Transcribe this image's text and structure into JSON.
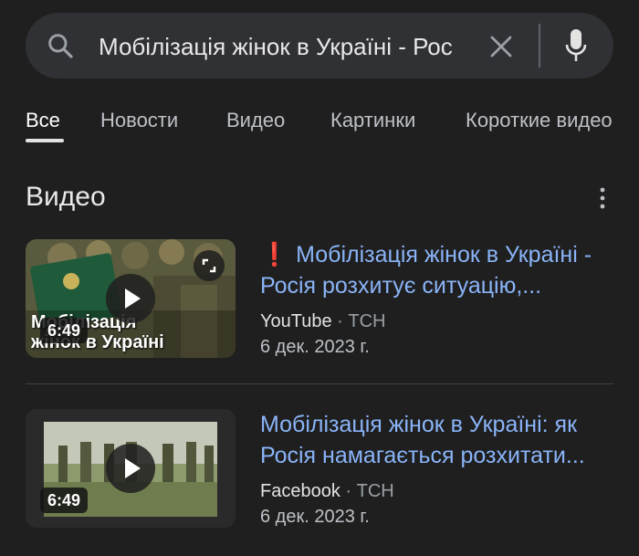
{
  "search": {
    "query": "Мобілізація жінок в Україні - Рос"
  },
  "tabs": [
    {
      "label": "Все",
      "active": true
    },
    {
      "label": "Новости",
      "active": false
    },
    {
      "label": "Видео",
      "active": false
    },
    {
      "label": "Картинки",
      "active": false
    },
    {
      "label": "Короткие видео",
      "active": false
    }
  ],
  "section": {
    "title": "Видео"
  },
  "videos": [
    {
      "title": "Мобілізація жінок в Україні - Росія розхитує ситуацію,...",
      "platform": "YouTube",
      "separator": " · ",
      "channel": "ТСН",
      "date": "6 дек. 2023 г.",
      "duration": "6:49",
      "thumb_caption_line1": "Мобілізація",
      "thumb_caption_line2": "жінок в Україні",
      "has_alert_icon": true
    },
    {
      "title": "Мобілізація жінок в Україні: як Росія намагається розхитати...",
      "platform": "Facebook",
      "separator": " · ",
      "channel": "ТСН",
      "date": "6 дек. 2023 г.",
      "duration": "6:49",
      "has_alert_icon": false
    }
  ],
  "icons": {
    "search": "search-icon",
    "clear": "close-icon",
    "mic": "mic-icon",
    "more": "more-vert-icon",
    "play": "play-icon",
    "expand": "expand-icon",
    "alert": "exclamation-icon"
  },
  "colors": {
    "background": "#1f1f1f",
    "search_bg": "#303134",
    "link": "#8ab4f8",
    "alert": "#ea4335",
    "text_primary": "#e3e3e3",
    "text_secondary": "#9aa0a6"
  }
}
